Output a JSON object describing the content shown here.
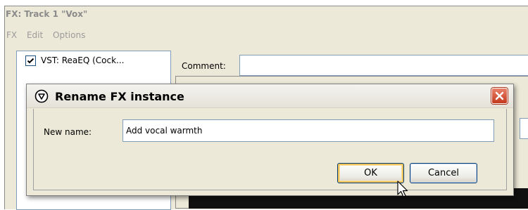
{
  "fx_window": {
    "title": "FX: Track 1 \"Vox\"",
    "menu": [
      "FX",
      "Edit",
      "Options"
    ],
    "fx_list": [
      {
        "label": "VST: ReaEQ (Cock...",
        "checked": true
      }
    ],
    "comment_label": "Comment:",
    "comment_value": ""
  },
  "dialog": {
    "title": "Rename FX instance",
    "new_name_label": "New name:",
    "new_name_value": "Add vocal warmth",
    "ok_label": "OK",
    "cancel_label": "Cancel",
    "icon": "reaper-logo-icon",
    "close_icon": "close-icon"
  },
  "colors": {
    "dialog_bg": "#ece9d8",
    "close_button": "#c3391c",
    "ok_focus": "#f0c35a"
  }
}
